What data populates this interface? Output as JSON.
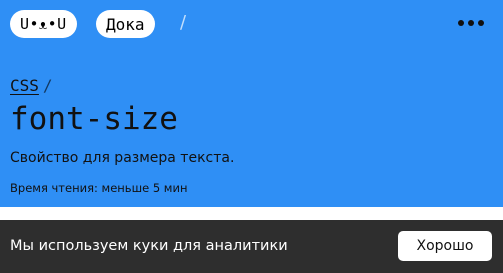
{
  "header": {
    "logo_text": "U•ᴥ•U",
    "site_name": "Дока",
    "separator": "/",
    "menu_icon": "more-horizontal-icon"
  },
  "article": {
    "breadcrumb": "CSS",
    "breadcrumb_separator": "/",
    "title": "font-size",
    "description": "Свойство для размера текста.",
    "reading_time": "Время чтения: меньше 5 мин"
  },
  "cookie_banner": {
    "text": "Мы используем куки для аналитики",
    "button_label": "Хорошо"
  },
  "colors": {
    "hero_background": "#2f8ff5",
    "banner_background": "#2e2e2e"
  }
}
